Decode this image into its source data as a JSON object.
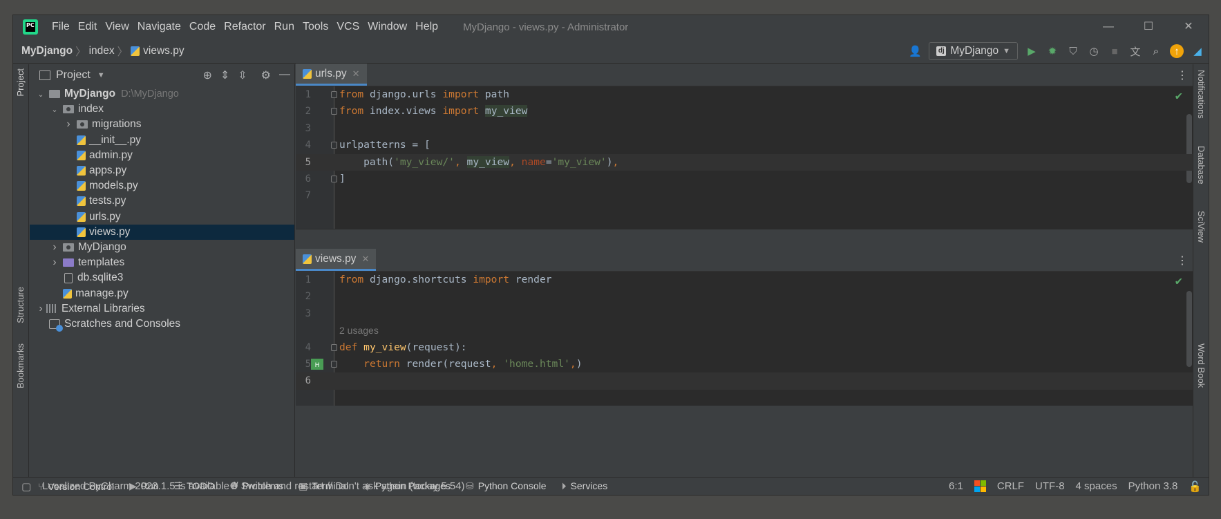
{
  "menu": [
    "File",
    "Edit",
    "View",
    "Navigate",
    "Code",
    "Refactor",
    "Run",
    "Tools",
    "VCS",
    "Window",
    "Help"
  ],
  "window_title": "MyDjango - views.py - Administrator",
  "breadcrumb": {
    "project": "MyDjango",
    "folder": "index",
    "file": "views.py"
  },
  "run_config": "MyDjango",
  "project_panel": {
    "title": "Project",
    "tree": [
      {
        "label": "MyDjango",
        "path": "D:\\MyDjango",
        "level": 0,
        "type": "root",
        "expanded": true
      },
      {
        "label": "index",
        "level": 1,
        "type": "package",
        "expanded": true
      },
      {
        "label": "migrations",
        "level": 2,
        "type": "package",
        "expanded": false
      },
      {
        "label": "__init__.py",
        "level": 2,
        "type": "py"
      },
      {
        "label": "admin.py",
        "level": 2,
        "type": "py"
      },
      {
        "label": "apps.py",
        "level": 2,
        "type": "py"
      },
      {
        "label": "models.py",
        "level": 2,
        "type": "py"
      },
      {
        "label": "tests.py",
        "level": 2,
        "type": "py"
      },
      {
        "label": "urls.py",
        "level": 2,
        "type": "py"
      },
      {
        "label": "views.py",
        "level": 2,
        "type": "py",
        "selected": true
      },
      {
        "label": "MyDjango",
        "level": 1,
        "type": "package",
        "expanded": false
      },
      {
        "label": "templates",
        "level": 1,
        "type": "template",
        "expanded": false
      },
      {
        "label": "db.sqlite3",
        "level": 1,
        "type": "db"
      },
      {
        "label": "manage.py",
        "level": 1,
        "type": "py"
      },
      {
        "label": "External Libraries",
        "level": 0,
        "type": "lib",
        "expanded": false
      },
      {
        "label": "Scratches and Consoles",
        "level": 0,
        "type": "scratch"
      }
    ]
  },
  "left_strip": {
    "project": "Project",
    "structure": "Structure",
    "bookmarks": "Bookmarks"
  },
  "right_strip": {
    "notifications": "Notifications",
    "database": "Database",
    "sciview": "SciView",
    "wordbook": "Word Book"
  },
  "editor_top": {
    "tab": "urls.py",
    "lines": [
      {
        "n": "1",
        "html": "<span class='kw'>from</span> django.urls <span class='kw'>import</span> path",
        "fold": true
      },
      {
        "n": "2",
        "html": "<span class='kw'>from</span> index.views <span class='kw'>import</span> <span class='hl'>my_view</span>",
        "fold": true
      },
      {
        "n": "3",
        "html": ""
      },
      {
        "n": "4",
        "html": "urlpatterns = [",
        "fold": true
      },
      {
        "n": "5",
        "html": "    path(<span class='str'>'my_view/'</span><span class='kw'>,</span> <span class='hl'>my_view</span><span class='kw'>,</span> <span class='param'>name</span>=<span class='str'>'my_view'</span>)<span class='kw'>,</span>",
        "cur": true
      },
      {
        "n": "6",
        "html": "]",
        "fold": true
      },
      {
        "n": "7",
        "html": ""
      }
    ]
  },
  "editor_bottom": {
    "tab": "views.py",
    "usages": "2 usages",
    "lines": [
      {
        "n": "1",
        "html": "<span class='kw'>from</span> django.shortcuts <span class='kw'>import</span> render"
      },
      {
        "n": "2",
        "html": ""
      },
      {
        "n": "3",
        "html": ""
      },
      {
        "n": "",
        "html": "<span class='usages'>2 usages</span>"
      },
      {
        "n": "4",
        "html": "<span class='kw'>def</span> <span class='fn'>my_view</span>(request):",
        "fold": true
      },
      {
        "n": "5",
        "html": "    <span class='kw'>return</span> render(request<span class='kw'>,</span> <span class='str'>'home.html'</span><span class='kw'>,</span>)",
        "fold": true,
        "marker": true
      },
      {
        "n": "6",
        "html": "",
        "cur": true
      }
    ]
  },
  "tool_windows": [
    {
      "icon": "⑂",
      "label": "Version Control"
    },
    {
      "icon": "▶",
      "label": "Run"
    },
    {
      "icon": "☰",
      "label": "TODO"
    },
    {
      "icon": "❶",
      "label": "Problems"
    },
    {
      "icon": "▣",
      "label": "Terminal"
    },
    {
      "icon": "◈",
      "label": "Python Packages"
    },
    {
      "icon": "⛁",
      "label": "Python Console"
    },
    {
      "icon": "⏵",
      "label": "Services"
    }
  ],
  "status": {
    "message": "Localized PyCharm 2023.1.5 is available // Switch and restart // Don't ask again (today 5:54)",
    "position": "6:1",
    "line_sep": "CRLF",
    "encoding": "UTF-8",
    "indent": "4 spaces",
    "interpreter": "Python 3.8"
  }
}
